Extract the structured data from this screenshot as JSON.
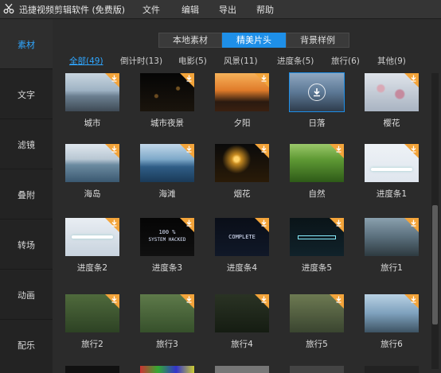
{
  "app": {
    "title": "迅捷视频剪辑软件 (免费版)"
  },
  "menu": [
    "文件",
    "编辑",
    "导出",
    "帮助"
  ],
  "sidebar": {
    "items": [
      {
        "label": "素材",
        "active": true
      },
      {
        "label": "文字"
      },
      {
        "label": "滤镜"
      },
      {
        "label": "叠附"
      },
      {
        "label": "转场"
      },
      {
        "label": "动画"
      },
      {
        "label": "配乐"
      }
    ]
  },
  "tabs": [
    {
      "label": "本地素材"
    },
    {
      "label": "精美片头",
      "active": true
    },
    {
      "label": "背景样例"
    }
  ],
  "categories": [
    {
      "label": "全部(49)",
      "active": true
    },
    {
      "label": "倒计时(13)"
    },
    {
      "label": "电影(5)"
    },
    {
      "label": "风景(11)"
    },
    {
      "label": "进度条(5)"
    },
    {
      "label": "旅行(6)"
    },
    {
      "label": "其他(9)"
    }
  ],
  "items": [
    {
      "label": "城市",
      "icon": "download-badge-icon"
    },
    {
      "label": "城市夜景",
      "icon": "download-badge-icon"
    },
    {
      "label": "夕阳",
      "icon": "download-badge-icon"
    },
    {
      "label": "日落",
      "icon": "download-circle-icon",
      "selected": true
    },
    {
      "label": "樱花",
      "icon": "download-badge-icon"
    },
    {
      "label": "海岛",
      "icon": "download-badge-icon"
    },
    {
      "label": "海滩",
      "icon": "download-badge-icon"
    },
    {
      "label": "烟花",
      "icon": "download-badge-icon"
    },
    {
      "label": "自然",
      "icon": "download-badge-icon"
    },
    {
      "label": "进度条1",
      "icon": "download-badge-icon"
    },
    {
      "label": "进度条2",
      "icon": "download-badge-icon"
    },
    {
      "label": "进度条3",
      "icon": "download-badge-icon",
      "thumb_text": [
        "100 %",
        "SYSTEM HACKED"
      ]
    },
    {
      "label": "进度条4",
      "icon": "download-badge-icon",
      "thumb_text": [
        "COMPLETE"
      ]
    },
    {
      "label": "进度条5",
      "icon": "download-badge-icon"
    },
    {
      "label": "旅行1",
      "icon": "download-badge-icon"
    },
    {
      "label": "旅行2",
      "icon": "download-badge-icon"
    },
    {
      "label": "旅行3",
      "icon": "download-badge-icon"
    },
    {
      "label": "旅行4",
      "icon": "download-badge-icon"
    },
    {
      "label": "旅行5",
      "icon": "download-badge-icon"
    },
    {
      "label": "旅行6",
      "icon": "download-badge-icon"
    }
  ],
  "colors": {
    "accent": "#1e8fe8",
    "badge": "#f3a43a",
    "active_text": "#2fa6ff",
    "background": "#2b2b2b",
    "sidebar": "#232323"
  }
}
